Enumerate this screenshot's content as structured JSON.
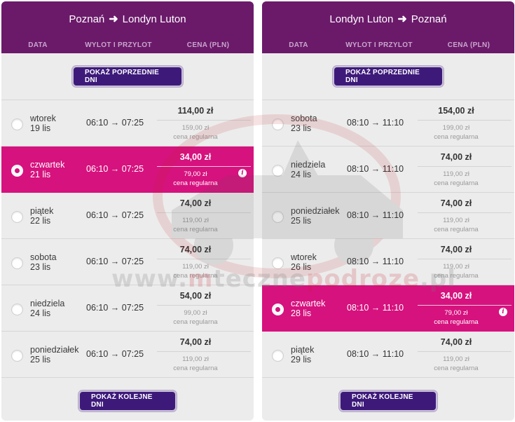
{
  "colors": {
    "header_bg": "#6b1a6a",
    "selected_bg": "#d6127e",
    "button_bg": "#3d1a7a",
    "panel_bg": "#ececec"
  },
  "columns": {
    "date": "DATA",
    "flight": "WYLOT I PRZYLOT",
    "price": "CENA (PLN)"
  },
  "buttons": {
    "prev": "POKAŻ POPRZEDNIE DNI",
    "next": "POKAŻ KOLEJNE DNI"
  },
  "regular_price_label": "cena regularna",
  "arrow_glyph": "→",
  "watermark": {
    "pre": "www.",
    "mid": "m",
    "rest": "teczne",
    "mid2": "podroze",
    "tld": ".pl"
  },
  "outbound": {
    "from": "Poznań",
    "to": "Londyn Luton",
    "rows": [
      {
        "weekday": "wtorek",
        "date": "19 lis",
        "dep": "06:10",
        "arr": "07:25",
        "price": "114,00 zł",
        "regular": "159,00 zł",
        "selected": false
      },
      {
        "weekday": "czwartek",
        "date": "21 lis",
        "dep": "06:10",
        "arr": "07:25",
        "price": "34,00 zł",
        "regular": "79,00 zł",
        "selected": true
      },
      {
        "weekday": "piątek",
        "date": "22 lis",
        "dep": "06:10",
        "arr": "07:25",
        "price": "74,00 zł",
        "regular": "119,00 zł",
        "selected": false
      },
      {
        "weekday": "sobota",
        "date": "23 lis",
        "dep": "06:10",
        "arr": "07:25",
        "price": "74,00 zł",
        "regular": "119,00 zł",
        "selected": false
      },
      {
        "weekday": "niedziela",
        "date": "24 lis",
        "dep": "06:10",
        "arr": "07:25",
        "price": "54,00 zł",
        "regular": "99,00 zł",
        "selected": false
      },
      {
        "weekday": "poniedziałek",
        "date": "25 lis",
        "dep": "06:10",
        "arr": "07:25",
        "price": "74,00 zł",
        "regular": "119,00 zł",
        "selected": false
      }
    ]
  },
  "return": {
    "from": "Londyn Luton",
    "to": "Poznań",
    "rows": [
      {
        "weekday": "sobota",
        "date": "23 lis",
        "dep": "08:10",
        "arr": "11:10",
        "price": "154,00 zł",
        "regular": "199,00 zł",
        "selected": false
      },
      {
        "weekday": "niedziela",
        "date": "24 lis",
        "dep": "08:10",
        "arr": "11:10",
        "price": "74,00 zł",
        "regular": "119,00 zł",
        "selected": false
      },
      {
        "weekday": "poniedziałek",
        "date": "25 lis",
        "dep": "08:10",
        "arr": "11:10",
        "price": "74,00 zł",
        "regular": "119,00 zł",
        "selected": false
      },
      {
        "weekday": "wtorek",
        "date": "26 lis",
        "dep": "08:10",
        "arr": "11:10",
        "price": "74,00 zł",
        "regular": "119,00 zł",
        "selected": false
      },
      {
        "weekday": "czwartek",
        "date": "28 lis",
        "dep": "08:10",
        "arr": "11:10",
        "price": "34,00 zł",
        "regular": "79,00 zł",
        "selected": true
      },
      {
        "weekday": "piątek",
        "date": "29 lis",
        "dep": "08:10",
        "arr": "11:10",
        "price": "74,00 zł",
        "regular": "119,00 zł",
        "selected": false
      }
    ]
  }
}
